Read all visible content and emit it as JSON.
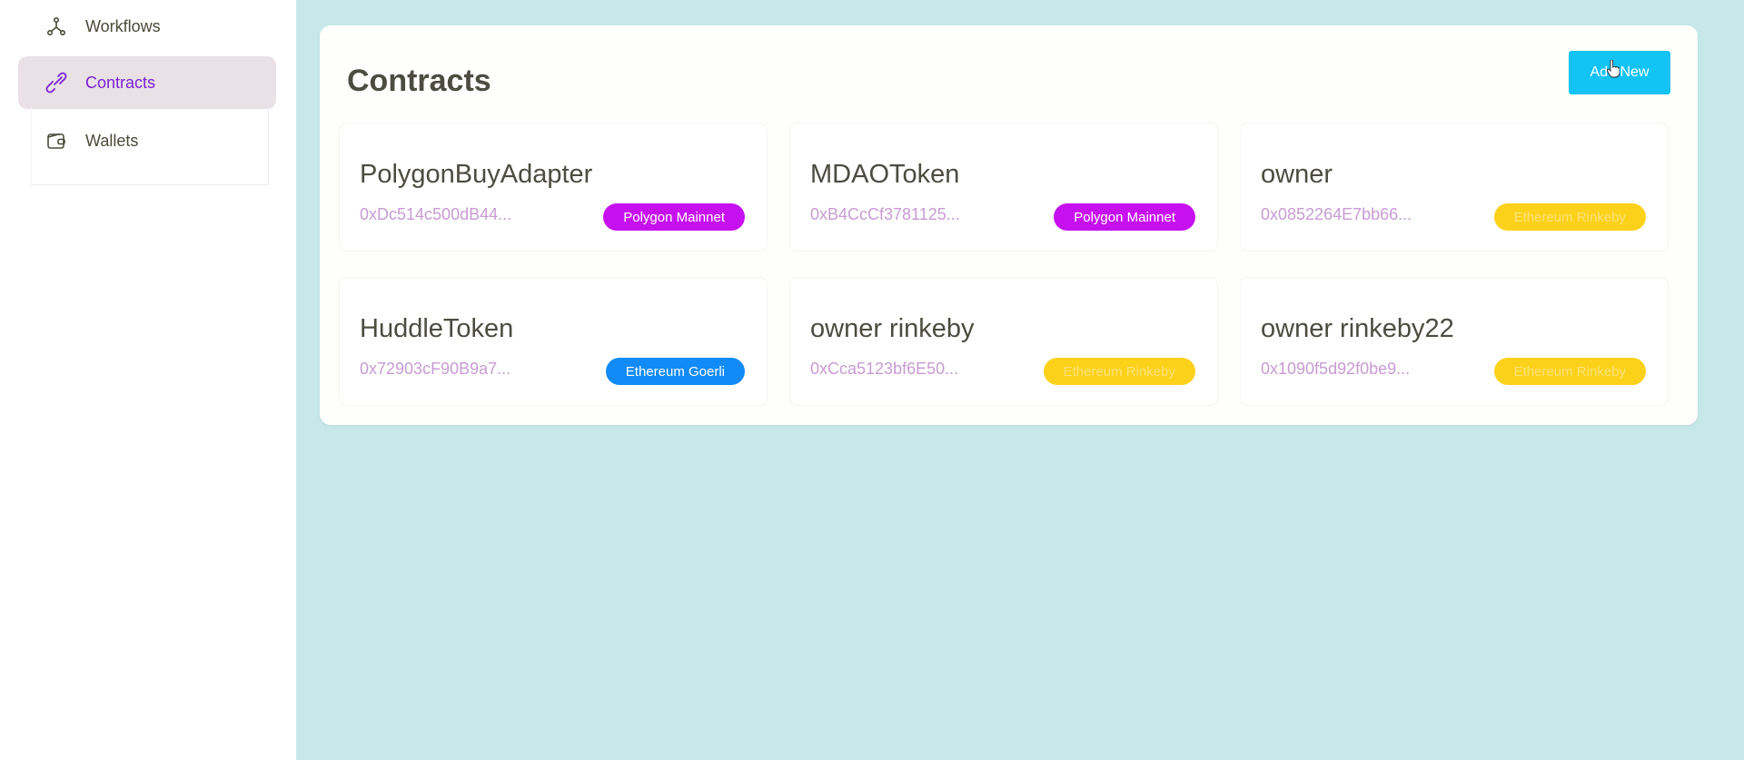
{
  "sidebar": {
    "items": [
      {
        "label": "Workflows",
        "icon": "workflow-icon",
        "active": false
      },
      {
        "label": "Contracts",
        "icon": "link-icon",
        "active": true
      },
      {
        "label": "Wallets",
        "icon": "wallet-icon",
        "active": false
      }
    ]
  },
  "main": {
    "title": "Contracts",
    "add_button_label": "Add New",
    "cards": [
      {
        "name": "PolygonBuyAdapter",
        "address": "0xDc514c500dB44...",
        "network": "Polygon Mainnet",
        "network_color": "#c710f0"
      },
      {
        "name": "MDAOToken",
        "address": "0xB4CcCf3781125...",
        "network": "Polygon Mainnet",
        "network_color": "#c710f0"
      },
      {
        "name": "owner",
        "address": "0x0852264E7bb66...",
        "network": "Ethereum Rinkeby",
        "network_color": "#fcd11a"
      },
      {
        "name": "HuddleToken",
        "address": "0x72903cF90B9a7...",
        "network": "Ethereum Goerli",
        "network_color": "#118bf7"
      },
      {
        "name": "owner rinkeby",
        "address": "0xCca5123bf6E50...",
        "network": "Ethereum Rinkeby",
        "network_color": "#fcd11a"
      },
      {
        "name": "owner rinkeby22",
        "address": "0x1090f5d92f0be9...",
        "network": "Ethereum Rinkeby",
        "network_color": "#fcd11a"
      }
    ]
  },
  "colors": {
    "accent": "#7a1fd6",
    "button": "#12c3f4",
    "main_bg": "#c6e8e9",
    "address": "#c79cd3"
  }
}
